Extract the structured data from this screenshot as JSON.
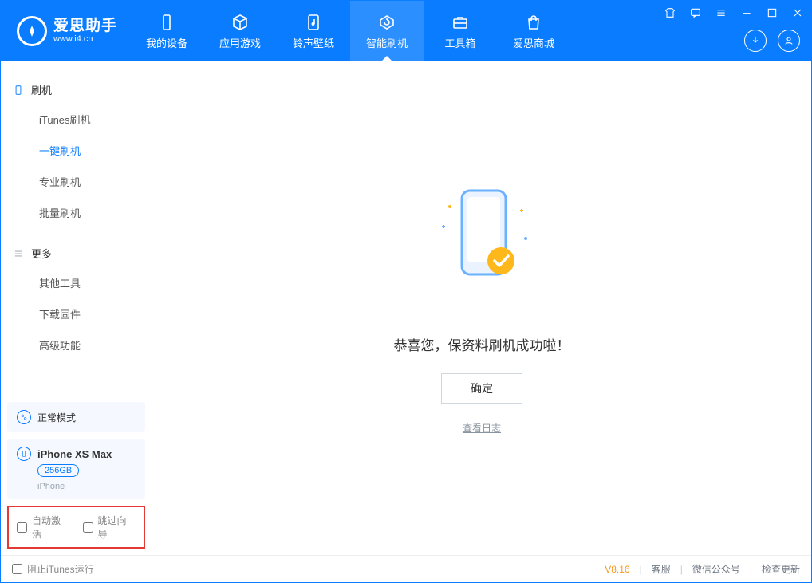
{
  "app": {
    "title": "爱思助手",
    "subtitle": "www.i4.cn"
  },
  "nav": {
    "tabs": [
      {
        "label": "我的设备",
        "icon": "device-icon"
      },
      {
        "label": "应用游戏",
        "icon": "cube-icon"
      },
      {
        "label": "铃声壁纸",
        "icon": "music-icon"
      },
      {
        "label": "智能刷机",
        "icon": "refresh-icon",
        "active": true
      },
      {
        "label": "工具箱",
        "icon": "toolbox-icon"
      },
      {
        "label": "爱思商城",
        "icon": "shop-icon"
      }
    ]
  },
  "sidebar": {
    "group1_title": "刷机",
    "group1_items": [
      {
        "label": "iTunes刷机"
      },
      {
        "label": "一键刷机",
        "active": true
      },
      {
        "label": "专业刷机"
      },
      {
        "label": "批量刷机"
      }
    ],
    "group2_title": "更多",
    "group2_items": [
      {
        "label": "其他工具"
      },
      {
        "label": "下载固件"
      },
      {
        "label": "高级功能"
      }
    ],
    "mode_card": {
      "label": "正常模式"
    },
    "device_card": {
      "name": "iPhone XS Max",
      "capacity": "256GB",
      "type": "iPhone"
    },
    "checks": {
      "auto_activate": "自动激活",
      "skip_guide": "跳过向导"
    }
  },
  "main": {
    "success_text": "恭喜您，保资料刷机成功啦！",
    "ok_label": "确定",
    "view_log": "查看日志"
  },
  "footer": {
    "block_itunes": "阻止iTunes运行",
    "version": "V8.16",
    "links": {
      "support": "客服",
      "wechat": "微信公众号",
      "update": "检查更新"
    }
  }
}
